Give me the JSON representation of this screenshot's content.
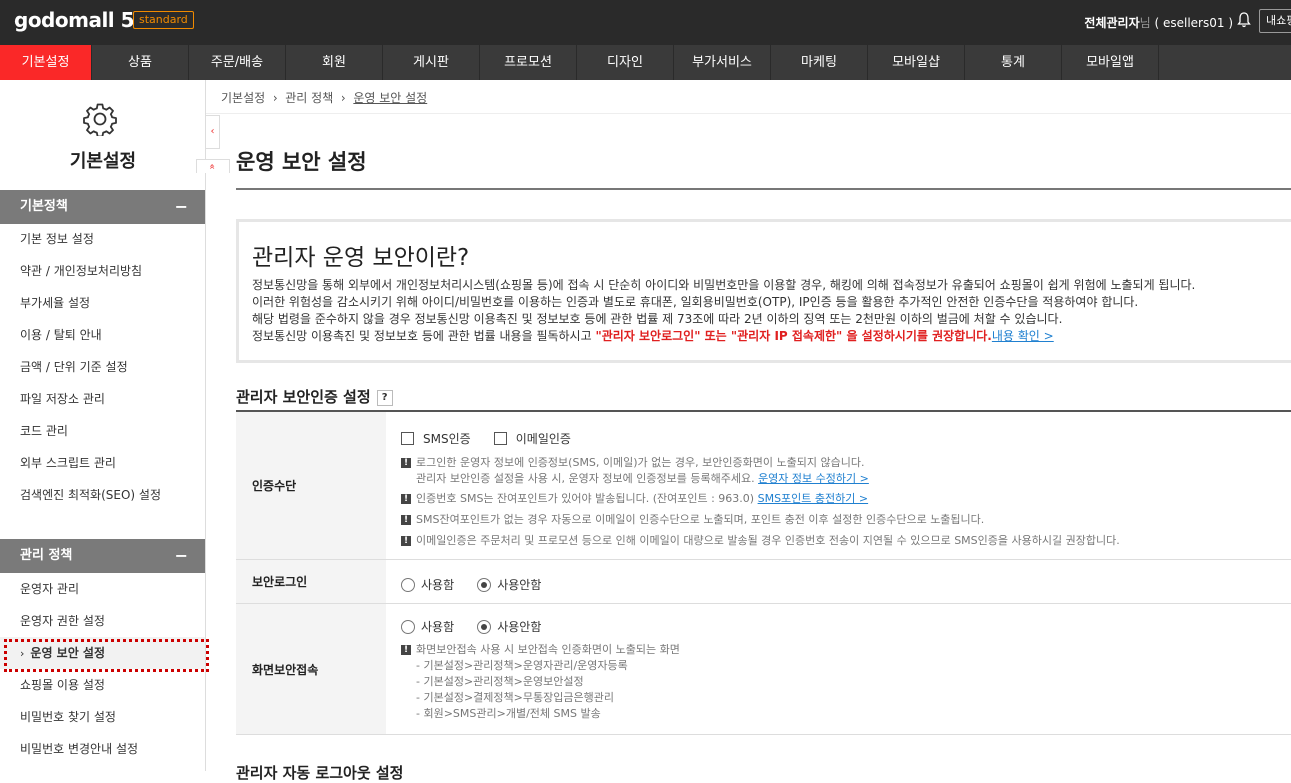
{
  "topbar": {
    "logo": "godomall 5",
    "badge": "standard",
    "user_role": "전체관리자",
    "user_suffix": "님",
    "user_id": "( esellers01 )",
    "mystore": "내쇼핑몰"
  },
  "mainnav": [
    {
      "label": "기본설정",
      "width": 92
    },
    {
      "label": "상품",
      "width": 97
    },
    {
      "label": "주문/배송",
      "width": 97
    },
    {
      "label": "회원",
      "width": 97
    },
    {
      "label": "게시판",
      "width": 97
    },
    {
      "label": "프로모션",
      "width": 97
    },
    {
      "label": "디자인",
      "width": 97
    },
    {
      "label": "부가서비스",
      "width": 97
    },
    {
      "label": "마케팅",
      "width": 97
    },
    {
      "label": "모바일샵",
      "width": 97
    },
    {
      "label": "통계",
      "width": 97
    },
    {
      "label": "모바일앱",
      "width": 97
    }
  ],
  "sidebar": {
    "title": "기본설정",
    "group1": "기본정책",
    "group1_items": [
      "기본 정보 설정",
      "약관 / 개인정보처리방침",
      "부가세율 설정",
      "이용 / 탈퇴 안내",
      "금액 / 단위 기준 설정",
      "파일 저장소 관리",
      "코드 관리",
      "외부 스크립트 관리",
      "검색엔진 최적화(SEO) 설정"
    ],
    "group2": "관리 정책",
    "group2_items": [
      "운영자 관리",
      "운영자 권한 설정",
      "운영 보안 설정",
      "쇼핑몰 이용 설정",
      "비밀번호 찾기 설정",
      "비밀번호 변경안내 설정"
    ],
    "minus": "−"
  },
  "collapse": {
    "left": "‹",
    "double": "»"
  },
  "breadcrumb": [
    "기본설정",
    "관리 정책",
    "운영 보안 설정"
  ],
  "page_title": "운영 보안 설정",
  "intro": {
    "heading": "관리자 운영 보안이란?",
    "line1": "정보통신망을 통해 외부에서 개인정보처리시스템(쇼핑몰 등)에 접속 시 단순히 아이디와 비밀번호만을 이용할 경우, 해킹에 의해 접속정보가 유출되어 쇼핑몰이 쉽게 위험에 노출되게 됩니다.",
    "line2": "이러한 위험성을 감소시키기 위해 아이디/비밀번호를 이용하는 인증과 별도로 휴대폰, 일회용비밀번호(OTP), IP인증 등을 활용한 추가적인 안전한 인증수단을 적용하여야 합니다.",
    "line3": "해당 법령을 준수하지 않을 경우 정보통신망 이용촉진 및 정보보호 등에 관한 법률 제 73조에 따라 2년 이하의 징역 또는 2천만원 이하의 벌금에 처할 수 있습니다.",
    "line4_pre": "정보통신망 이용촉진 및 정보보호 등에 관한 법률 내용을 필독하시고 ",
    "line4_red": "\"관리자 보안로그인\" 또는 \"관리자 IP 접속제한\" 을 설정하시기를 권장합니다.",
    "line4_link": "내용 확인 >"
  },
  "section": {
    "title": "관리자 보안인증 설정",
    "help": "?",
    "auth": {
      "label": "인증수단",
      "sms": "SMS인증",
      "email": "이메일인증",
      "note1a": "로그인한 운영자 정보에 인증정보(SMS, 이메일)가 없는 경우, 보안인증화면이 노출되지 않습니다.",
      "note1b_pre": "관리자 보안인증 설정을 사용 시, 운영자 정보에 인증정보를 등록해주세요. ",
      "note1b_link": "운영자 정보 수정하기 >",
      "note2_pre": "인증번호 SMS는 잔여포인트가 있어야 발송됩니다. (잔여포인트 : 963.0) ",
      "note2_link": "SMS포인트 충전하기 >",
      "note3": "SMS잔여포인트가 없는 경우 자동으로 이메일이 인증수단으로 노출되며, 포인트 충전 이후 설정한 인증수단으로 노출됩니다.",
      "note4": "이메일인증은 주문처리 및 프로모션 등으로 인해 이메일이 대량으로 발송될 경우 인증번호 전송이 지연될 수 있으므로 SMS인증을 사용하시길 권장합니다."
    },
    "login": {
      "label": "보안로그인",
      "use": "사용함",
      "nouse": "사용안함"
    },
    "screen": {
      "label": "화면보안접속",
      "use": "사용함",
      "nouse": "사용안함",
      "note": "화면보안접속 사용 시 보안접속 인증화면이 노출되는 화면",
      "paths": [
        "- 기본설정>관리정책>운영자관리/운영자등록",
        "- 기본설정>관리정책>운영보안설정",
        "- 기본설정>결제정책>무통장입금은행관리",
        "- 회원>SMS관리>개별/전체 SMS 발송"
      ]
    }
  },
  "next_title": "관리자 자동 로그아웃 설정"
}
